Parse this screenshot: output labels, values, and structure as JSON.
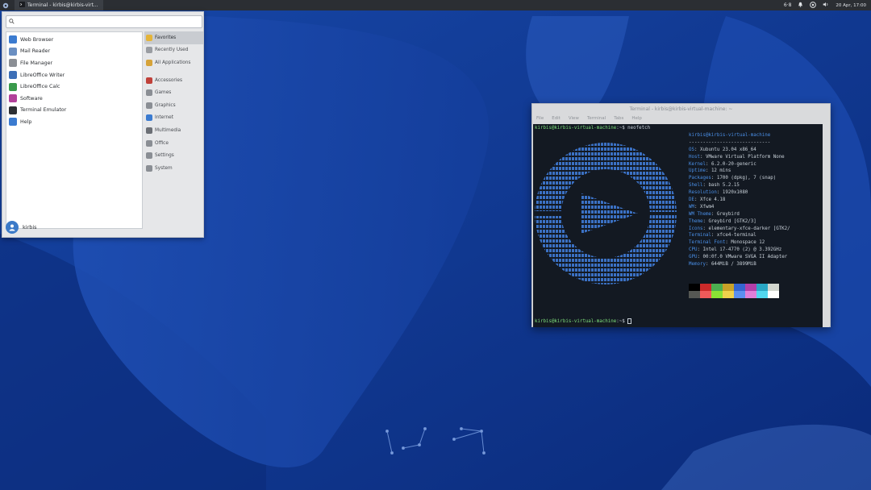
{
  "colors": {
    "panel_bg": "#2b2e33",
    "desktop_bg": "#0d2f86",
    "terminal_bg": "#131922",
    "prompt_green": "#7ee07b",
    "label_blue": "#4a8fe7"
  },
  "top_panel": {
    "menu_icon": "xubuntu-menu-icon",
    "task_label": "Terminal - kirbis@kirbis-virt...",
    "tray": {
      "keyboard": "6·8",
      "clock": "20 Apr, 17:00"
    }
  },
  "menu": {
    "search_placeholder": "",
    "apps": [
      {
        "label": "Web Browser",
        "icon": "globe-icon",
        "color": "#3b7bd0"
      },
      {
        "label": "Mail Reader",
        "icon": "mail-icon",
        "color": "#6a8fc2"
      },
      {
        "label": "File Manager",
        "icon": "folder-icon",
        "color": "#8b8f95"
      },
      {
        "label": "LibreOffice Writer",
        "icon": "writer-icon",
        "color": "#3d6fb7"
      },
      {
        "label": "LibreOffice Calc",
        "icon": "calc-icon",
        "color": "#3a9a4c"
      },
      {
        "label": "Software",
        "icon": "software-icon",
        "color": "#b2419a"
      },
      {
        "label": "Terminal Emulator",
        "icon": "terminal-icon",
        "color": "#2c2f33"
      },
      {
        "label": "Help",
        "icon": "help-icon",
        "color": "#3b7bd0"
      }
    ],
    "categories_top": [
      {
        "label": "Favorites",
        "icon": "star-icon",
        "color": "#e4b43a",
        "selected": true
      },
      {
        "label": "Recently Used",
        "icon": "clock-icon",
        "color": "#9a9da2",
        "selected": false
      },
      {
        "label": "All Applications",
        "icon": "grid-icon",
        "color": "#d6a33a",
        "selected": false
      }
    ],
    "categories": [
      {
        "label": "Accessories",
        "icon": "accessories-icon",
        "color": "#c0413a"
      },
      {
        "label": "Games",
        "icon": "games-icon",
        "color": "#8a8e94"
      },
      {
        "label": "Graphics",
        "icon": "graphics-icon",
        "color": "#8a8e94"
      },
      {
        "label": "Internet",
        "icon": "internet-icon",
        "color": "#3b7bd0"
      },
      {
        "label": "Multimedia",
        "icon": "multimedia-icon",
        "color": "#6b6f75"
      },
      {
        "label": "Office",
        "icon": "office-icon",
        "color": "#8a8e94"
      },
      {
        "label": "Settings",
        "icon": "settings-icon",
        "color": "#8a8e94"
      },
      {
        "label": "System",
        "icon": "system-icon",
        "color": "#8a8e94"
      }
    ],
    "user": "kirbis"
  },
  "terminal": {
    "title": "Terminal - kirbis@kirbis-virtual-machine: ~",
    "menubar": [
      "File",
      "Edit",
      "View",
      "Terminal",
      "Tabs",
      "Help"
    ],
    "command_prompt": "kirbis@kirbis-virtual-machine",
    "command_suffix": ":~$ neofetch",
    "info_header_user": "kirbis",
    "info_header_host": "@kirbis-virtual-machine",
    "info_rule": "-----------------------------",
    "info": [
      {
        "key": "OS",
        "value": "Xubuntu 23.04 x86_64"
      },
      {
        "key": "Host",
        "value": "VMware Virtual Platform None"
      },
      {
        "key": "Kernel",
        "value": "6.2.0-20-generic"
      },
      {
        "key": "Uptime",
        "value": "12 mins"
      },
      {
        "key": "Packages",
        "value": "1700 (dpkg), 7 (snap)"
      },
      {
        "key": "Shell",
        "value": "bash 5.2.15"
      },
      {
        "key": "Resolution",
        "value": "1920x1080"
      },
      {
        "key": "DE",
        "value": "Xfce 4.18"
      },
      {
        "key": "WM",
        "value": "Xfwm4"
      },
      {
        "key": "WM Theme",
        "value": "Greybird"
      },
      {
        "key": "Theme",
        "value": "Greybird [GTK2/3]"
      },
      {
        "key": "Icons",
        "value": "elementary-xfce-darker [GTK2/"
      },
      {
        "key": "Terminal",
        "value": "xfce4-terminal"
      },
      {
        "key": "Terminal Font",
        "value": "Monospace 12"
      },
      {
        "key": "CPU",
        "value": "Intel i7-4770 (2) @ 3.392GHz"
      },
      {
        "key": "GPU",
        "value": "00:0f.0 VMware SVGA II Adapter"
      },
      {
        "key": "Memory",
        "value": "644MiB / 3899MiB"
      }
    ],
    "palette": [
      "#000000",
      "#cc2a2a",
      "#4caf50",
      "#c9a227",
      "#3465d0",
      "#b33fa8",
      "#2aa7c4",
      "#d3d7cf",
      "#555753",
      "#ef5a5a",
      "#8ae234",
      "#f0d24c",
      "#5b8ff0",
      "#e07fd8",
      "#52d7ef",
      "#ffffff"
    ],
    "last_prompt": "kirbis@kirbis-virtual-machine",
    "last_suffix": ":~$ "
  }
}
